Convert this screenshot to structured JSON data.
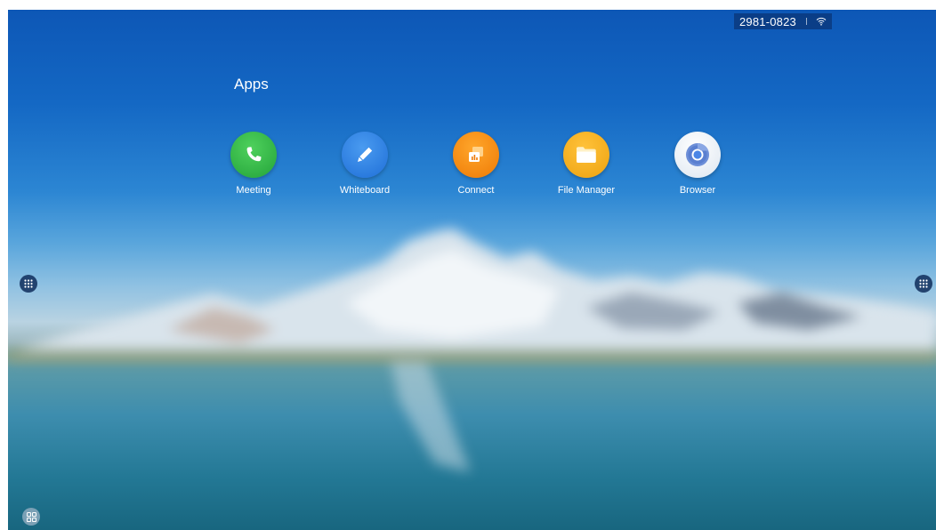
{
  "status_bar": {
    "meeting_id": "2981-0823",
    "wifi_icon": "wifi-icon"
  },
  "apps_section": {
    "title": "Apps"
  },
  "apps": [
    {
      "label": "Meeting",
      "icon": "phone-icon",
      "color": "#2fb344"
    },
    {
      "label": "Whiteboard",
      "icon": "pen-icon",
      "color": "#2f7ee0"
    },
    {
      "label": "Connect",
      "icon": "connect-icon",
      "color": "#f28c0f"
    },
    {
      "label": "File Manager",
      "icon": "folder-icon",
      "color": "#f0a818"
    },
    {
      "label": "Browser",
      "icon": "browser-icon",
      "color": "#e8eef6"
    }
  ],
  "side_buttons": {
    "left_icon": "app-grid-icon",
    "right_icon": "app-grid-icon"
  },
  "bottom_button": {
    "icon": "windows-grid-icon"
  }
}
